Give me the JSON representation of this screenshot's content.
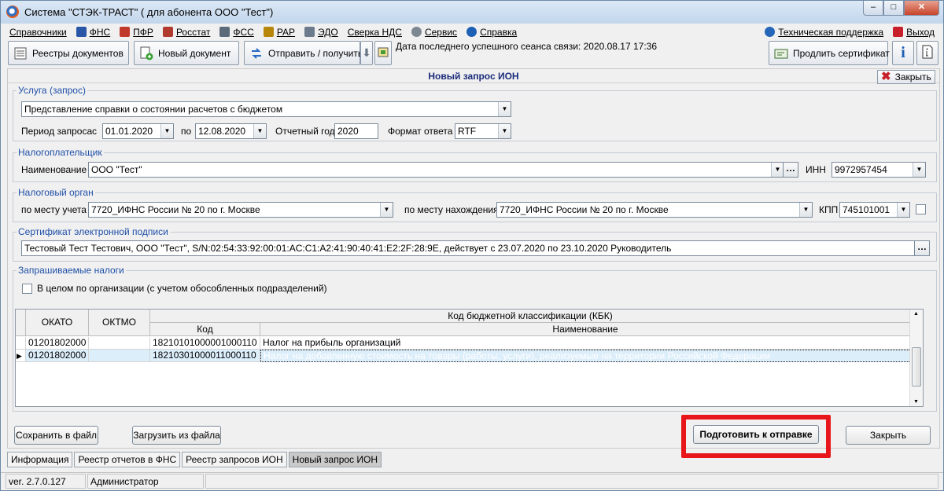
{
  "window": {
    "title": "Система \"СТЭК-ТРАСТ\" ( для абонента ООО \"Тест\")",
    "min": "–",
    "max": "□",
    "close": "✕"
  },
  "menu": [
    {
      "label": "Справочники",
      "icon": "none"
    },
    {
      "label": "ФНС",
      "icon": "fns-icon",
      "color": "#2a56a8"
    },
    {
      "label": "ПФР",
      "icon": "pfr-icon",
      "color": "#c0392b"
    },
    {
      "label": "Росстат",
      "icon": "rosstat-icon",
      "color": "#b03a2e"
    },
    {
      "label": "ФСС",
      "icon": "fss-icon",
      "color": "#5c6b7a"
    },
    {
      "label": "РАР",
      "icon": "rar-icon",
      "color": "#b8860b"
    },
    {
      "label": "ЭДО",
      "icon": "edo-icon",
      "color": "#6b7b8c"
    },
    {
      "label": "Сверка НДС",
      "icon": "none"
    },
    {
      "label": "Сервис",
      "icon": "gear-icon",
      "color": "#7d8792"
    },
    {
      "label": "Справка",
      "icon": "help-icon",
      "color": "#1d5fb5"
    }
  ],
  "menu_right": [
    {
      "label": "Техническая поддержка",
      "icon": "globe-icon",
      "color": "#2566b8"
    },
    {
      "label": "Выход",
      "icon": "exit-icon",
      "color": "#c8202a"
    }
  ],
  "toolbar": {
    "registers": "Реестры документов",
    "new_doc": "Новый документ",
    "send_receive": "Отправить / получить",
    "last_session": "Дата последнего успешного сеанса связи: 2020.08.17 17:36",
    "renew_cert": "Продлить сертификат",
    "info_label": "i"
  },
  "panel": {
    "title": "Новый запрос ИОН",
    "close": "Закрыть",
    "service": {
      "legend": "Услуга (запрос)",
      "value": "Представление справки о состоянии расчетов с бюджетом",
      "period_label": "Период запроса",
      "from_label": "с",
      "from": "01.01.2020",
      "to_label": "по",
      "to": "12.08.2020",
      "year_label": "Отчетный год",
      "year": "2020",
      "format_label": "Формат ответа",
      "format": "RTF"
    },
    "taxpayer": {
      "legend": "Налогоплательщик",
      "name_label": "Наименование",
      "name": "ООО \"Тест\"",
      "inn_label": "ИНН",
      "inn": "9972957454"
    },
    "tax_authority": {
      "legend": "Налоговый орган",
      "reg_label": "по месту учета",
      "reg": "7720_ИФНС России № 20 по г. Москве",
      "loc_label": "по месту нахождения",
      "loc": "7720_ИФНС России № 20 по г. Москве",
      "kpp_label": "КПП",
      "kpp": "745101001"
    },
    "cert": {
      "legend": "Сертификат электронной подписи",
      "value": "Тестовый Тест Тестович, ООО \"Тест\", S/N:02:54:33:92:00:01:AC:C1:A2:41:90:40:41:E2:2F:28:9E, действует с 23.07.2020 по 23.10.2020 Руководитель"
    },
    "taxes": {
      "legend": "Запрашиваемые налоги",
      "whole_org": "В целом по организации (с учетом обособленных подразделений)",
      "columns": {
        "okato": "ОКАТО",
        "oktmo": "ОКТМО",
        "kbk_group": "Код бюджетной классификации (КБК)",
        "code": "Код",
        "name": "Наименование"
      },
      "rows": [
        {
          "okato": "01201802000",
          "oktmo": "",
          "code": "18210101000001000110",
          "name": "Налог на прибыль организаций"
        },
        {
          "okato": "01201802000",
          "oktmo": "",
          "code": "18210301000011000110",
          "name": "Налог на добавленную стоимость на товары (работы, услуги), реализуемые на территории Российской Федерации"
        }
      ]
    },
    "buttons": {
      "save_file": "Сохранить в файл",
      "load_file": "Загрузить из файла",
      "prepare": "Подготовить к отправке",
      "close": "Закрыть"
    }
  },
  "tabs": [
    "Информация",
    "Реестр отчетов в ФНС",
    "Реестр запросов ИОН",
    "Новый запрос ИОН"
  ],
  "status": {
    "version": "ver. 2.7.0.127",
    "user": "Администратор"
  }
}
